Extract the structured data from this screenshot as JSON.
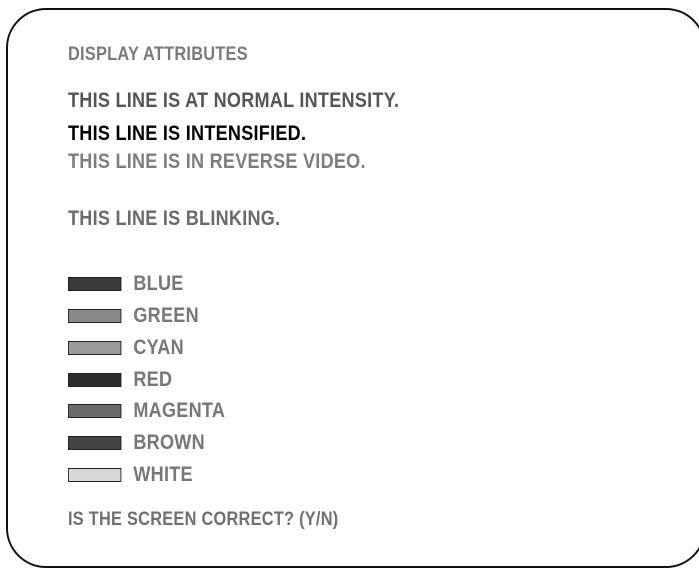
{
  "screen": {
    "title": "DISPLAY ATTRIBUTES",
    "normal_line": "THIS LINE IS AT NORMAL INTENSITY.",
    "intensified_line": "THIS LINE IS INTENSIFIED.",
    "reverse_line": "THIS LINE IS IN REVERSE VIDEO.",
    "blinking_line": "THIS LINE IS BLINKING.",
    "colors": [
      {
        "label": "BLUE",
        "swatch": "#3a3a3a"
      },
      {
        "label": "GREEN",
        "swatch": "#8a8a8a"
      },
      {
        "label": "CYAN",
        "swatch": "#9a9a9a"
      },
      {
        "label": "RED",
        "swatch": "#2e2e2e"
      },
      {
        "label": "MAGENTA",
        "swatch": "#6a6a6a"
      },
      {
        "label": "BROWN",
        "swatch": "#444444"
      },
      {
        "label": "WHITE",
        "swatch": "#d8d8d8"
      }
    ],
    "prompt": "IS THE SCREEN CORRECT? (Y/N)"
  }
}
